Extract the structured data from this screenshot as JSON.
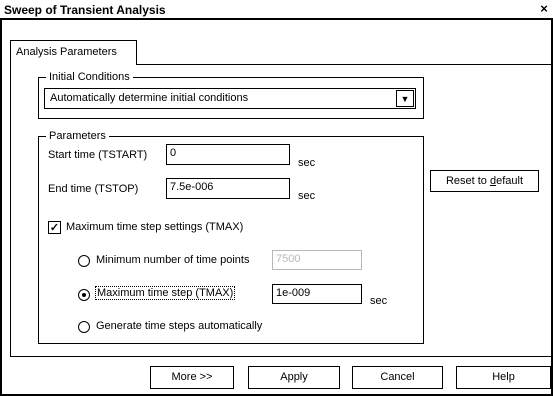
{
  "window": {
    "title": "Sweep of Transient Analysis",
    "close_glyph": "×"
  },
  "tabs": [
    {
      "label": "Analysis Parameters"
    }
  ],
  "initial_conditions": {
    "legend": "Initial Conditions",
    "selected": "Automatically determine initial conditions",
    "dropdown_glyph": "▼"
  },
  "parameters": {
    "legend": "Parameters",
    "start_time_label": "Start time (TSTART)",
    "start_time_value": "0",
    "start_time_unit": "sec",
    "end_time_label": "End time (TSTOP)",
    "end_time_value": "7.5e-006",
    "end_time_unit": "sec",
    "tmax_checkbox_label": "Maximum time step settings (TMAX)",
    "tmax_checked": true,
    "check_glyph": "✓",
    "radio_min_points_label": "Minimum number of time points",
    "min_points_value": "7500",
    "radio_max_step_label": "Maximum time step (TMAX)",
    "max_step_value": "1e-009",
    "max_step_unit": "sec",
    "radio_auto_label": "Generate time steps automatically",
    "selected_radio": "max_step"
  },
  "reset_button": {
    "label_pre": "Reset to ",
    "label_ul": "d",
    "label_post": "efault"
  },
  "footer": {
    "more_label": "More >>",
    "apply_label": "Apply",
    "cancel_label": "Cancel",
    "help_label": "Help"
  }
}
